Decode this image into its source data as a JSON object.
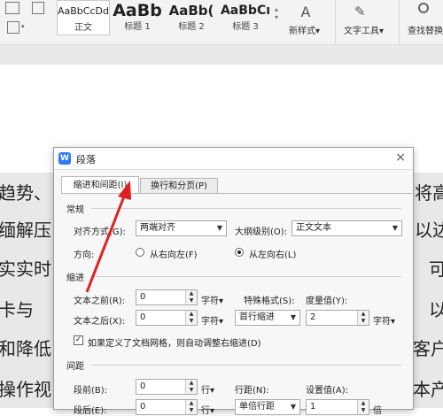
{
  "ribbon": {
    "styles": [
      {
        "preview": "AaBbCcDd",
        "name": "正文"
      },
      {
        "preview": "AaBb",
        "name": "标题 1"
      },
      {
        "preview": "AaBb(",
        "name": "标题 2"
      },
      {
        "preview": "AaBbCı",
        "name": "标题 3"
      }
    ],
    "new_style": "新样式",
    "text_tools": "文字工具",
    "find_replace": "查找替换"
  },
  "document": {
    "left_lines": [
      "趋势、",
      "缅解压",
      "实实时",
      "卡与",
      "和降低",
      "操作视"
    ],
    "right_lines": [
      "将高",
      "以达",
      "可",
      "以",
      "客户",
      "本产"
    ]
  },
  "dialog": {
    "title": "段落",
    "close": "×",
    "tabs": [
      "缩进和间距(I)",
      "换行和分页(P)"
    ],
    "general": {
      "section": "常规",
      "alignment_label": "对齐方式(G):",
      "alignment_value": "两端对齐",
      "outline_label": "大纲级别(O):",
      "outline_value": "正文文本",
      "direction_label": "方向:",
      "rtl": "从右向左(F)",
      "ltr": "从左向右(L)",
      "direction_selected": "ltr"
    },
    "indent": {
      "section": "缩进",
      "before_label": "文本之前(R):",
      "before_value": "0",
      "after_label": "文本之后(X):",
      "after_value": "0",
      "unit": "字符",
      "special_label": "特殊格式(S):",
      "special_value": "首行缩进",
      "measure_label": "度量值(Y):",
      "measure_value": "2",
      "measure_unit": "字符",
      "grid_checkbox": "如果定义了文档网格，则自动调整右缩进(D)",
      "grid_checked": true
    },
    "spacing": {
      "section": "间距",
      "before_label": "段前(B):",
      "before_value": "0",
      "after_label": "段后(E):",
      "after_value": "0",
      "unit": "行",
      "line_label": "行距(N):",
      "line_value": "单倍行距",
      "setting_label": "设置值(A):",
      "setting_value": "1",
      "setting_unit": "倍"
    }
  },
  "colors": {
    "annotation_arrow": "#e02020",
    "app_logo": "#2f7bf5"
  }
}
